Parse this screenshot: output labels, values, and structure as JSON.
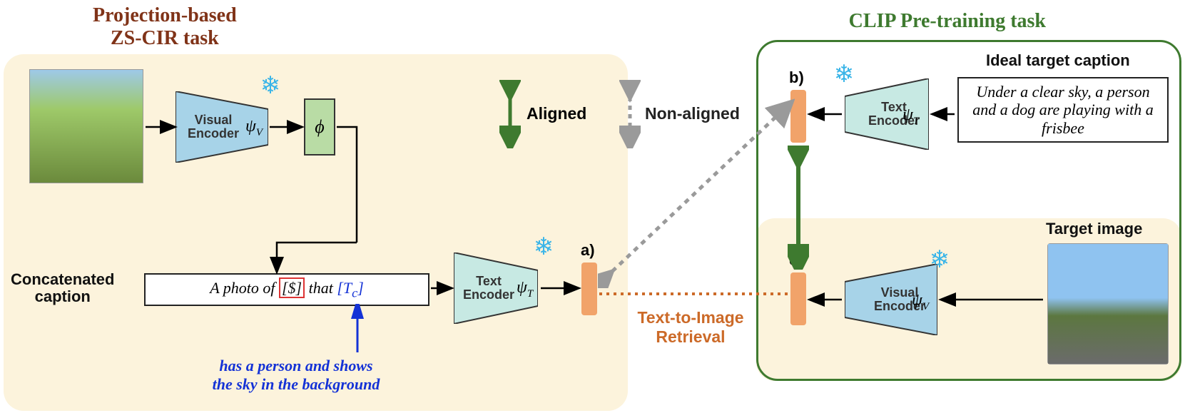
{
  "titles": {
    "left_line1": "Projection-based",
    "left_line2": "ZS-CIR task",
    "right": "CLIP Pre-training task"
  },
  "labels": {
    "visual_encoder": "Visual\nEncoder",
    "text_encoder": "Text\nEncoder",
    "psi_v": "ψ",
    "psi_v_sub": "V",
    "psi_t": "ψ",
    "psi_t_sub": "T",
    "phi": "ϕ",
    "aligned": "Aligned",
    "non_aligned": "Non-aligned",
    "concat_caption": "Concatenated",
    "concat_caption2": "caption",
    "ideal_target": "Ideal target caption",
    "target_image": "Target image",
    "a": "a)",
    "b": "b)",
    "c": "c)",
    "retrieval1": "Text-to-Image",
    "retrieval2": "Retrieval"
  },
  "captions": {
    "concat_prefix": "A photo of ",
    "concat_token": "[$]",
    "concat_mid": " that ",
    "concat_tc": "[T",
    "concat_tc_sub": "c",
    "concat_tc_close": "]",
    "modif_line1": "has a person and shows",
    "modif_line2": "the sky in the background",
    "ideal": "Under a clear sky, a person and a dog are playing with a frisbee"
  },
  "figure_description": "Diagram illustrating a projection-based zero-shot composed image retrieval (ZS-CIR) task on the left and CLIP pre-training alignment on the right. A reference image is encoded by a frozen visual encoder psi_V, projected by phi into a pseudo-token [$], concatenated into a caption template 'A photo of [$] that [T_c]', encoded by frozen text encoder psi_T to embedding a). On the right, an ideal target caption is encoded by psi_T to b), and target image by psi_V to c). b) and c) are aligned (CLIP), a) is non-aligned with b). Text-to-image retrieval compares a) with c)."
}
